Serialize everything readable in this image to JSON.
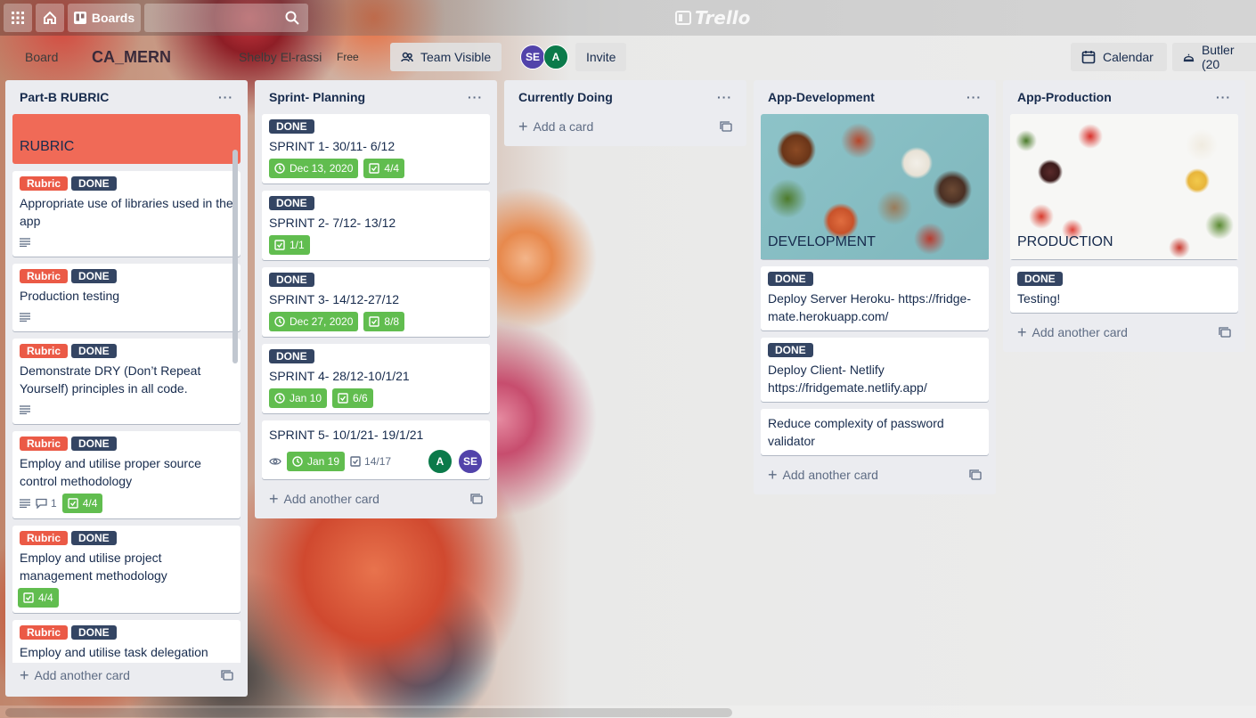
{
  "header": {
    "boards_label": "Boards",
    "logo_text": "Trello"
  },
  "boardbar": {
    "board_label": "Board",
    "board_title": "CA_MERN",
    "team_name": "Shelby El-rassi",
    "plan": "Free",
    "visibility": "Team Visible",
    "members": [
      "SE",
      "A"
    ],
    "invite": "Invite",
    "calendar": "Calendar",
    "butler": "Butler (20"
  },
  "lists": [
    {
      "title": "Part-B RUBRIC",
      "cover_title": "RUBRIC",
      "cards": [
        {
          "labels": [
            "Rubric",
            "DONE"
          ],
          "title": "Appropriate use of libraries used in the app"
        },
        {
          "labels": [
            "Rubric",
            "DONE"
          ],
          "title": "Production testing"
        },
        {
          "labels": [
            "Rubric",
            "DONE"
          ],
          "title": "Demonstrate DRY (Don’t Repeat Yourself) principles in all code."
        },
        {
          "labels": [
            "Rubric",
            "DONE"
          ],
          "title": "Employ and utilise proper source control methodology",
          "comments": "1",
          "checklist": "4/4"
        },
        {
          "labels": [
            "Rubric",
            "DONE"
          ],
          "title": "Employ and utilise project management methodology",
          "checklist": "4/4"
        },
        {
          "labels": [
            "Rubric",
            "DONE"
          ],
          "title": "Employ and utilise task delegation"
        }
      ],
      "add_label": "Add another card"
    },
    {
      "title": "Sprint- Planning",
      "cards": [
        {
          "labels": [
            "DONE"
          ],
          "title": "SPRINT 1- 30/11- 6/12",
          "due": "Dec 13, 2020",
          "checklist": "4/4"
        },
        {
          "labels": [
            "DONE"
          ],
          "title": "SPRINT 2- 7/12- 13/12",
          "checklist": "1/1"
        },
        {
          "labels": [
            "DONE"
          ],
          "title": "SPRINT 3- 14/12-27/12",
          "due": "Dec 27, 2020",
          "checklist": "8/8"
        },
        {
          "labels": [
            "DONE"
          ],
          "title": "SPRINT 4- 28/12-10/1/21",
          "due": "Jan 10",
          "checklist": "6/6"
        },
        {
          "labels": [],
          "title": "SPRINT 5- 10/1/21- 19/1/21",
          "due": "Jan 19",
          "checklist": "14/17",
          "members": [
            "A",
            "SE"
          ]
        }
      ],
      "add_label": "Add another card"
    },
    {
      "title": "Currently Doing",
      "cards": [],
      "add_label": "Add a card"
    },
    {
      "title": "App-Development",
      "cover_title": "DEVELOPMENT",
      "cards": [
        {
          "labels": [
            "DONE"
          ],
          "title": "Deploy Server Heroku- https://fridge-mate.herokuapp.com/"
        },
        {
          "labels": [
            "DONE"
          ],
          "title": "Deploy Client- Netlify https://fridgemate.netlify.app/"
        },
        {
          "labels": [],
          "title": "Reduce complexity of password validator"
        }
      ],
      "add_label": "Add another card"
    },
    {
      "title": "App-Production",
      "cover_title": "PRODUCTION",
      "cards": [
        {
          "labels": [
            "DONE"
          ],
          "title": "Testing!"
        }
      ],
      "add_label": "Add another card"
    }
  ],
  "colors": {
    "label_rubric": "#eb5a46",
    "label_done": "#344563",
    "badge_green": "#61bd4f",
    "list_bg": "#ebecf0",
    "cover_red": "#f06a57"
  },
  "icons": {
    "apps": "apps-grid-icon",
    "home": "home-icon",
    "search": "search-icon",
    "menu": "more-dots-icon",
    "description": "description-icon",
    "clock": "clock-icon",
    "checklist": "checklist-icon",
    "comment": "comment-icon",
    "watch": "eye-icon",
    "template": "card-template-icon"
  }
}
